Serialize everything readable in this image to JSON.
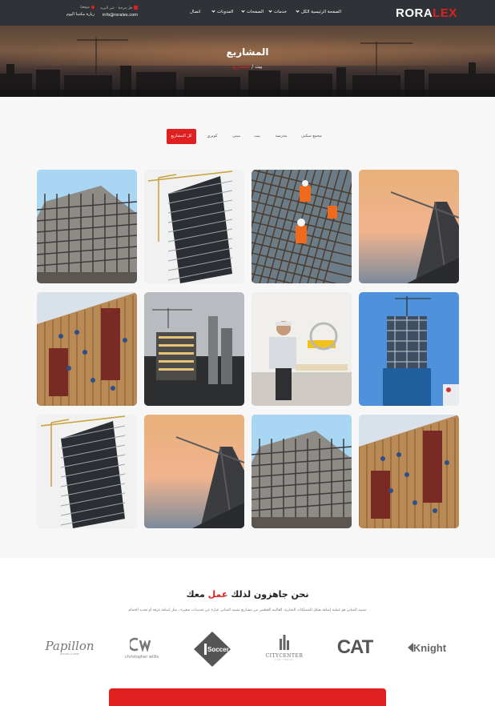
{
  "header": {
    "logo_main": "RORA",
    "logo_accent": "LEX",
    "nav": [
      {
        "label": "الصفحة الرئيسية الكل",
        "has_dropdown": true
      },
      {
        "label": "خدمات",
        "has_dropdown": true
      },
      {
        "label": "الصفحات",
        "has_dropdown": true
      },
      {
        "label": "المدونات",
        "has_dropdown": true
      },
      {
        "label": "اتصال",
        "has_dropdown": false
      }
    ],
    "contact": {
      "email_label": "قل مرحبا - عبر البريد",
      "email_value": "info@roralex.com",
      "location_label": "موقعنا",
      "location_value": "زيارة مكتبنا اليوم"
    }
  },
  "banner": {
    "title": "المشاريع",
    "breadcrumb_home": "بيت",
    "breadcrumb_separator": "/",
    "breadcrumb_current": "المشاريع"
  },
  "filters": [
    {
      "label": "كل المشاريع",
      "active": true
    },
    {
      "label": "كوبري",
      "active": false
    },
    {
      "label": "مبنى",
      "active": false
    },
    {
      "label": "بيت",
      "active": false
    },
    {
      "label": "مدرسة",
      "active": false
    },
    {
      "label": "مجمع سكني",
      "active": false
    }
  ],
  "gallery": [
    {
      "name": "project-image-1",
      "scene": "building-frame"
    },
    {
      "name": "project-image-2",
      "scene": "tower-crane"
    },
    {
      "name": "project-image-3",
      "scene": "rebar-workers"
    },
    {
      "name": "project-image-4",
      "scene": "sunset-crane"
    },
    {
      "name": "project-image-5",
      "scene": "roof-workers"
    },
    {
      "name": "project-image-6",
      "scene": "city-night"
    },
    {
      "name": "project-image-7",
      "scene": "saw-worker"
    },
    {
      "name": "project-image-8",
      "scene": "blue-tower"
    },
    {
      "name": "project-image-9",
      "scene": "tower-crane"
    },
    {
      "name": "project-image-10",
      "scene": "sunset-crane"
    },
    {
      "name": "project-image-11",
      "scene": "building-frame"
    },
    {
      "name": "project-image-12",
      "scene": "roof-workers"
    }
  ],
  "ready": {
    "title_before": "نحن جاهزون لذلك",
    "title_accent": "عمل",
    "title_after": "معك",
    "subtitle": "تشييد المباني هو عملية إضافة هيكل للممتلكات التجارية. الغالبية العظمى من مشاريع تشييد المباني عبارة عن تجديدات صغيرة ، مثل إضافة غرفة أو تجديد الحمام"
  },
  "brands": [
    {
      "name": "Papillon",
      "sub": "WEDDING & EVENT"
    },
    {
      "name": "christopher willis",
      "sub": ""
    },
    {
      "name": "Soccer",
      "sub": ""
    },
    {
      "name": "CITYCENTER",
      "sub": "LAS VEGAS"
    },
    {
      "name": "CAT",
      "sub": ""
    },
    {
      "name": "Knight",
      "sub": ""
    }
  ],
  "colors": {
    "accent": "#e02020",
    "header_bg": "#2f3236",
    "section_bg": "#f7f7f7"
  }
}
